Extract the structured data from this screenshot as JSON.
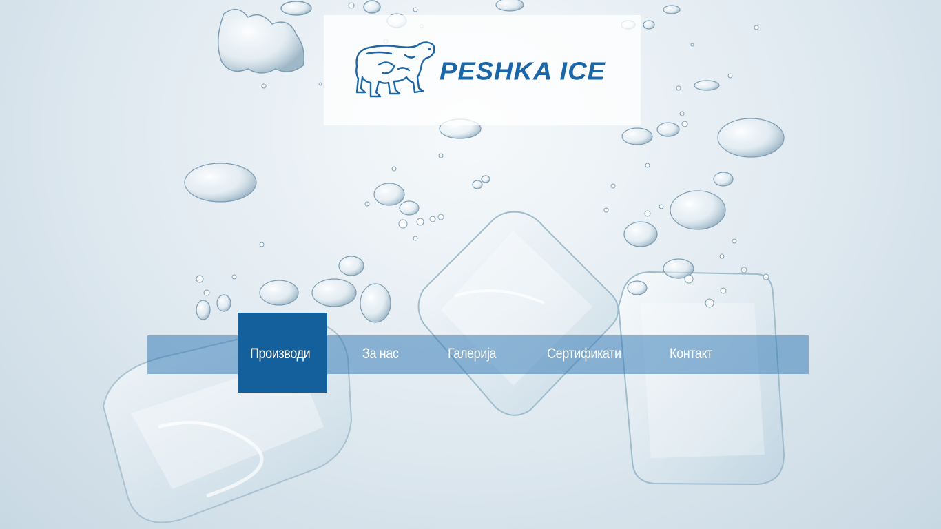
{
  "brand": {
    "name": "PESHKA ICE",
    "logo_icon": "polar-bear-icon",
    "color": "#1b66a6"
  },
  "nav": {
    "items": [
      {
        "label": "Производи",
        "active": true
      },
      {
        "label": "За нас",
        "active": false
      },
      {
        "label": "Галерија",
        "active": false
      },
      {
        "label": "Сертификати",
        "active": false
      },
      {
        "label": "Контакт",
        "active": false
      }
    ],
    "active_color": "#13609d",
    "bar_color": "#3278b4"
  }
}
